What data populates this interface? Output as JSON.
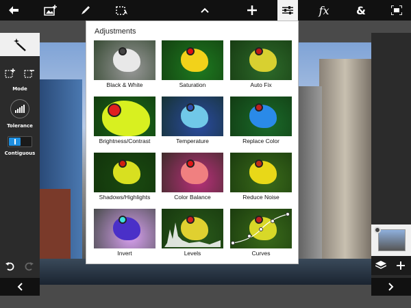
{
  "toolbar": {
    "items": [
      {
        "name": "back-arrow-icon",
        "active": false
      },
      {
        "name": "add-image-icon",
        "active": false
      },
      {
        "name": "brush-icon",
        "active": false
      },
      {
        "name": "selection-tool-icon",
        "active": false
      },
      {
        "name": "chevron-up-icon",
        "active": false
      },
      {
        "name": "add-icon",
        "active": false
      },
      {
        "name": "adjustments-sliders-icon",
        "active": true
      },
      {
        "name": "effects-fx-icon",
        "active": false
      },
      {
        "name": "blend-ampersand-icon",
        "active": false
      },
      {
        "name": "fullscreen-icon",
        "active": false
      }
    ],
    "fx_label": "fx",
    "ampersand_label": "&"
  },
  "left_panel": {
    "mode_label": "Mode",
    "tolerance_label": "Tolerance",
    "contiguous_label": "Contiguous"
  },
  "adjustments": {
    "title": "Adjustments",
    "items": [
      {
        "label": "Black & White",
        "bg": "#9a9a9a",
        "frog": "#e8e8e8",
        "eye": "#444444"
      },
      {
        "label": "Saturation",
        "bg": "#1e7a20",
        "frog": "#f2d21a",
        "eye": "#e01010"
      },
      {
        "label": "Auto Fix",
        "bg": "#2d6a2a",
        "frog": "#d8d030",
        "eye": "#c01818"
      },
      {
        "label": "Brightness/Contrast",
        "bg": "#1a6a1a",
        "frog": "#d8f020",
        "eye": "#e02020"
      },
      {
        "label": "Temperature",
        "bg": "#2a4aa0",
        "frog": "#70c8e8",
        "eye": "#3050b0"
      },
      {
        "label": "Replace Color",
        "bg": "#1a6a2a",
        "frog": "#2a8ae8",
        "eye": "#c02020"
      },
      {
        "label": "Shadows/Highlights",
        "bg": "#1a4a10",
        "frog": "#d8e020",
        "eye": "#d02010"
      },
      {
        "label": "Color Balance",
        "bg": "#b8307a",
        "frog": "#f08080",
        "eye": "#e01818"
      },
      {
        "label": "Reduce Noise",
        "bg": "#3a6a1a",
        "frog": "#e8d818",
        "eye": "#c03018"
      },
      {
        "label": "Invert",
        "bg": "#d8a0f0",
        "frog": "#4a30c8",
        "eye": "#40e0e0"
      },
      {
        "label": "Levels",
        "bg": "#2a5a1a",
        "frog": "#e0d030",
        "eye": "#d02020"
      },
      {
        "label": "Curves",
        "bg": "#3a6a1a",
        "frog": "#d8d828",
        "eye": "#c02020"
      }
    ]
  }
}
